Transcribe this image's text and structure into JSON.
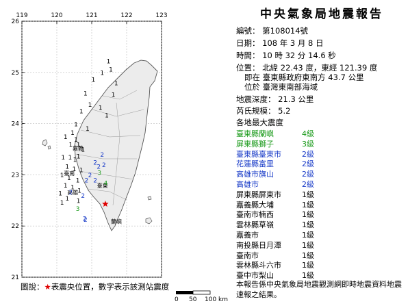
{
  "report": {
    "title": "中央氣象局地震報告",
    "number": "編號： 第108014號",
    "date": "日期： 108 年 3 月 8 日",
    "time": "時間： 10 時 32 分 14.6 秒",
    "location_1": "位置： 北緯 22.43 度，東經 121.39 度",
    "location_2": "即在 臺東縣政府東南方 43.7 公里",
    "location_3": "位於 臺灣東南部海域",
    "depth": "地震深度： 21.3 公里",
    "magnitude": "芮氏規模： 5.2",
    "intensity_header": "各地最大震度"
  },
  "intensity_list": [
    {
      "station": "臺東縣蘭嶼",
      "level": "4級",
      "color": "#1a9a1a"
    },
    {
      "station": "屏東縣獅子",
      "level": "3級",
      "color": "#1a9a1a"
    },
    {
      "station": "臺東縣臺東市",
      "level": "2級",
      "color": "#1a3cc8"
    },
    {
      "station": "花蓮縣富里",
      "level": "2級",
      "color": "#1a3cc8"
    },
    {
      "station": "高雄市旗山",
      "level": "2級",
      "color": "#1a3cc8"
    },
    {
      "station": "高雄市",
      "level": "2級",
      "color": "#1a3cc8"
    },
    {
      "station": "屏東縣屏東市",
      "level": "1級",
      "color": "#000000"
    },
    {
      "station": "嘉義縣大埔",
      "level": "1級",
      "color": "#000000"
    },
    {
      "station": "臺南市楠西",
      "level": "1級",
      "color": "#000000"
    },
    {
      "station": "雲林縣草嶺",
      "level": "1級",
      "color": "#000000"
    },
    {
      "station": "嘉義市",
      "level": "1級",
      "color": "#000000"
    },
    {
      "station": "南投縣日月潭",
      "level": "1級",
      "color": "#000000"
    },
    {
      "station": "臺南市",
      "level": "1級",
      "color": "#000000"
    },
    {
      "station": "雲林縣斗六市",
      "level": "1級",
      "color": "#000000"
    },
    {
      "station": "臺中市梨山",
      "level": "1級",
      "color": "#000000"
    }
  ],
  "footer_note": "本報告係中央氣象局地震觀測網即時地震資料地震速報之結果。",
  "legend": {
    "prefix": "圖說：",
    "star": "★",
    "star_label": "表震央位置，數字表示該測站震度"
  },
  "map": {
    "lon_ticks": [
      "119",
      "120",
      "121",
      "122",
      "123"
    ],
    "lat_ticks": [
      "26",
      "25",
      "24",
      "23",
      "22",
      "21"
    ],
    "scale_labels": [
      "0",
      "50",
      "100",
      "km"
    ],
    "place_labels": [
      {
        "text": "臺東",
        "lon": 121.15,
        "lat": 22.75
      },
      {
        "text": "蘭嶼",
        "lon": 121.55,
        "lat": 22.05
      },
      {
        "text": "嘉義",
        "lon": 120.45,
        "lat": 23.48
      },
      {
        "text": "臺南",
        "lon": 120.2,
        "lat": 22.99
      },
      {
        "text": "高雄",
        "lon": 120.3,
        "lat": 22.62
      }
    ],
    "stations": [
      {
        "v": "1",
        "lon": 121.48,
        "lat": 25.18,
        "c": "#000"
      },
      {
        "v": "1",
        "lon": 121.55,
        "lat": 25.02,
        "c": "#000"
      },
      {
        "v": "1",
        "lon": 121.3,
        "lat": 24.95,
        "c": "#000"
      },
      {
        "v": "1",
        "lon": 121.05,
        "lat": 24.82,
        "c": "#000"
      },
      {
        "v": "1",
        "lon": 121.7,
        "lat": 24.75,
        "c": "#000"
      },
      {
        "v": "1",
        "lon": 121.62,
        "lat": 24.52,
        "c": "#000"
      },
      {
        "v": "1",
        "lon": 120.82,
        "lat": 24.55,
        "c": "#000"
      },
      {
        "v": "1",
        "lon": 120.95,
        "lat": 24.33,
        "c": "#000"
      },
      {
        "v": "1",
        "lon": 120.7,
        "lat": 24.2,
        "c": "#000"
      },
      {
        "v": "1",
        "lon": 121.25,
        "lat": 24.27,
        "c": "#000"
      },
      {
        "v": "1",
        "lon": 121.43,
        "lat": 24.12,
        "c": "#000"
      },
      {
        "v": "1",
        "lon": 120.55,
        "lat": 23.95,
        "c": "#000"
      },
      {
        "v": "1",
        "lon": 120.45,
        "lat": 23.78,
        "c": "#000"
      },
      {
        "v": "1",
        "lon": 120.55,
        "lat": 23.65,
        "c": "#000"
      },
      {
        "v": "1",
        "lon": 120.25,
        "lat": 23.7,
        "c": "#000"
      },
      {
        "v": "1",
        "lon": 120.88,
        "lat": 23.86,
        "c": "#000"
      },
      {
        "v": "1",
        "lon": 120.62,
        "lat": 23.55,
        "c": "#000"
      },
      {
        "v": "1",
        "lon": 120.4,
        "lat": 23.55,
        "c": "#000"
      },
      {
        "v": "1",
        "lon": 120.75,
        "lat": 23.45,
        "c": "#000"
      },
      {
        "v": "1",
        "lon": 120.18,
        "lat": 23.3,
        "c": "#000"
      },
      {
        "v": "1",
        "lon": 120.38,
        "lat": 23.3,
        "c": "#000"
      },
      {
        "v": "1",
        "lon": 120.52,
        "lat": 23.25,
        "c": "#000"
      },
      {
        "v": "1",
        "lon": 120.62,
        "lat": 23.32,
        "c": "#000"
      },
      {
        "v": "1",
        "lon": 120.3,
        "lat": 23.12,
        "c": "#000"
      },
      {
        "v": "1",
        "lon": 120.5,
        "lat": 23.07,
        "c": "#000"
      },
      {
        "v": "1",
        "lon": 120.15,
        "lat": 22.95,
        "c": "#000"
      },
      {
        "v": "1",
        "lon": 120.35,
        "lat": 22.9,
        "c": "#000"
      },
      {
        "v": "1",
        "lon": 120.6,
        "lat": 22.85,
        "c": "#000"
      },
      {
        "v": "1",
        "lon": 120.25,
        "lat": 22.75,
        "c": "#000"
      },
      {
        "v": "1",
        "lon": 120.45,
        "lat": 22.72,
        "c": "#000"
      },
      {
        "v": "1",
        "lon": 120.65,
        "lat": 22.65,
        "c": "#000"
      },
      {
        "v": "1",
        "lon": 120.1,
        "lat": 22.6,
        "c": "#000"
      },
      {
        "v": "1",
        "lon": 120.3,
        "lat": 22.5,
        "c": "#000"
      },
      {
        "v": "1",
        "lon": 120.62,
        "lat": 22.45,
        "c": "#000"
      },
      {
        "v": "1",
        "lon": 120.15,
        "lat": 22.42,
        "c": "#000"
      },
      {
        "v": "1",
        "lon": 120.7,
        "lat": 23.05,
        "c": "#000"
      },
      {
        "v": "2",
        "lon": 121.3,
        "lat": 23.35,
        "c": "#1a3cc8"
      },
      {
        "v": "2",
        "lon": 121.1,
        "lat": 23.2,
        "c": "#1a3cc8"
      },
      {
        "v": "2",
        "lon": 121.2,
        "lat": 23.12,
        "c": "#1a3cc8"
      },
      {
        "v": "2",
        "lon": 121.35,
        "lat": 23.15,
        "c": "#1a3cc8"
      },
      {
        "v": "2",
        "lon": 120.95,
        "lat": 22.95,
        "c": "#1a3cc8"
      },
      {
        "v": "2",
        "lon": 120.85,
        "lat": 22.85,
        "c": "#1a3cc8"
      },
      {
        "v": "2",
        "lon": 121.1,
        "lat": 22.85,
        "c": "#1a3cc8"
      },
      {
        "v": "2",
        "lon": 120.75,
        "lat": 22.55,
        "c": "#1a3cc8"
      },
      {
        "v": "2",
        "lon": 120.4,
        "lat": 22.62,
        "c": "#1a3cc8"
      },
      {
        "v": "2",
        "lon": 120.8,
        "lat": 22.1,
        "c": "#1a3cc8"
      },
      {
        "v": "2",
        "lon": 120.82,
        "lat": 22.08,
        "c": "#1a3cc8"
      },
      {
        "v": "3",
        "lon": 121.22,
        "lat": 23.0,
        "c": "#1a9a1a"
      },
      {
        "v": "3",
        "lon": 120.6,
        "lat": 22.3,
        "c": "#1a9a1a"
      },
      {
        "v": "4",
        "lon": 121.4,
        "lat": 22.8,
        "c": "#1a9a1a"
      }
    ],
    "epicenter": {
      "lon": 121.39,
      "lat": 22.43,
      "color": "#e00000"
    }
  }
}
